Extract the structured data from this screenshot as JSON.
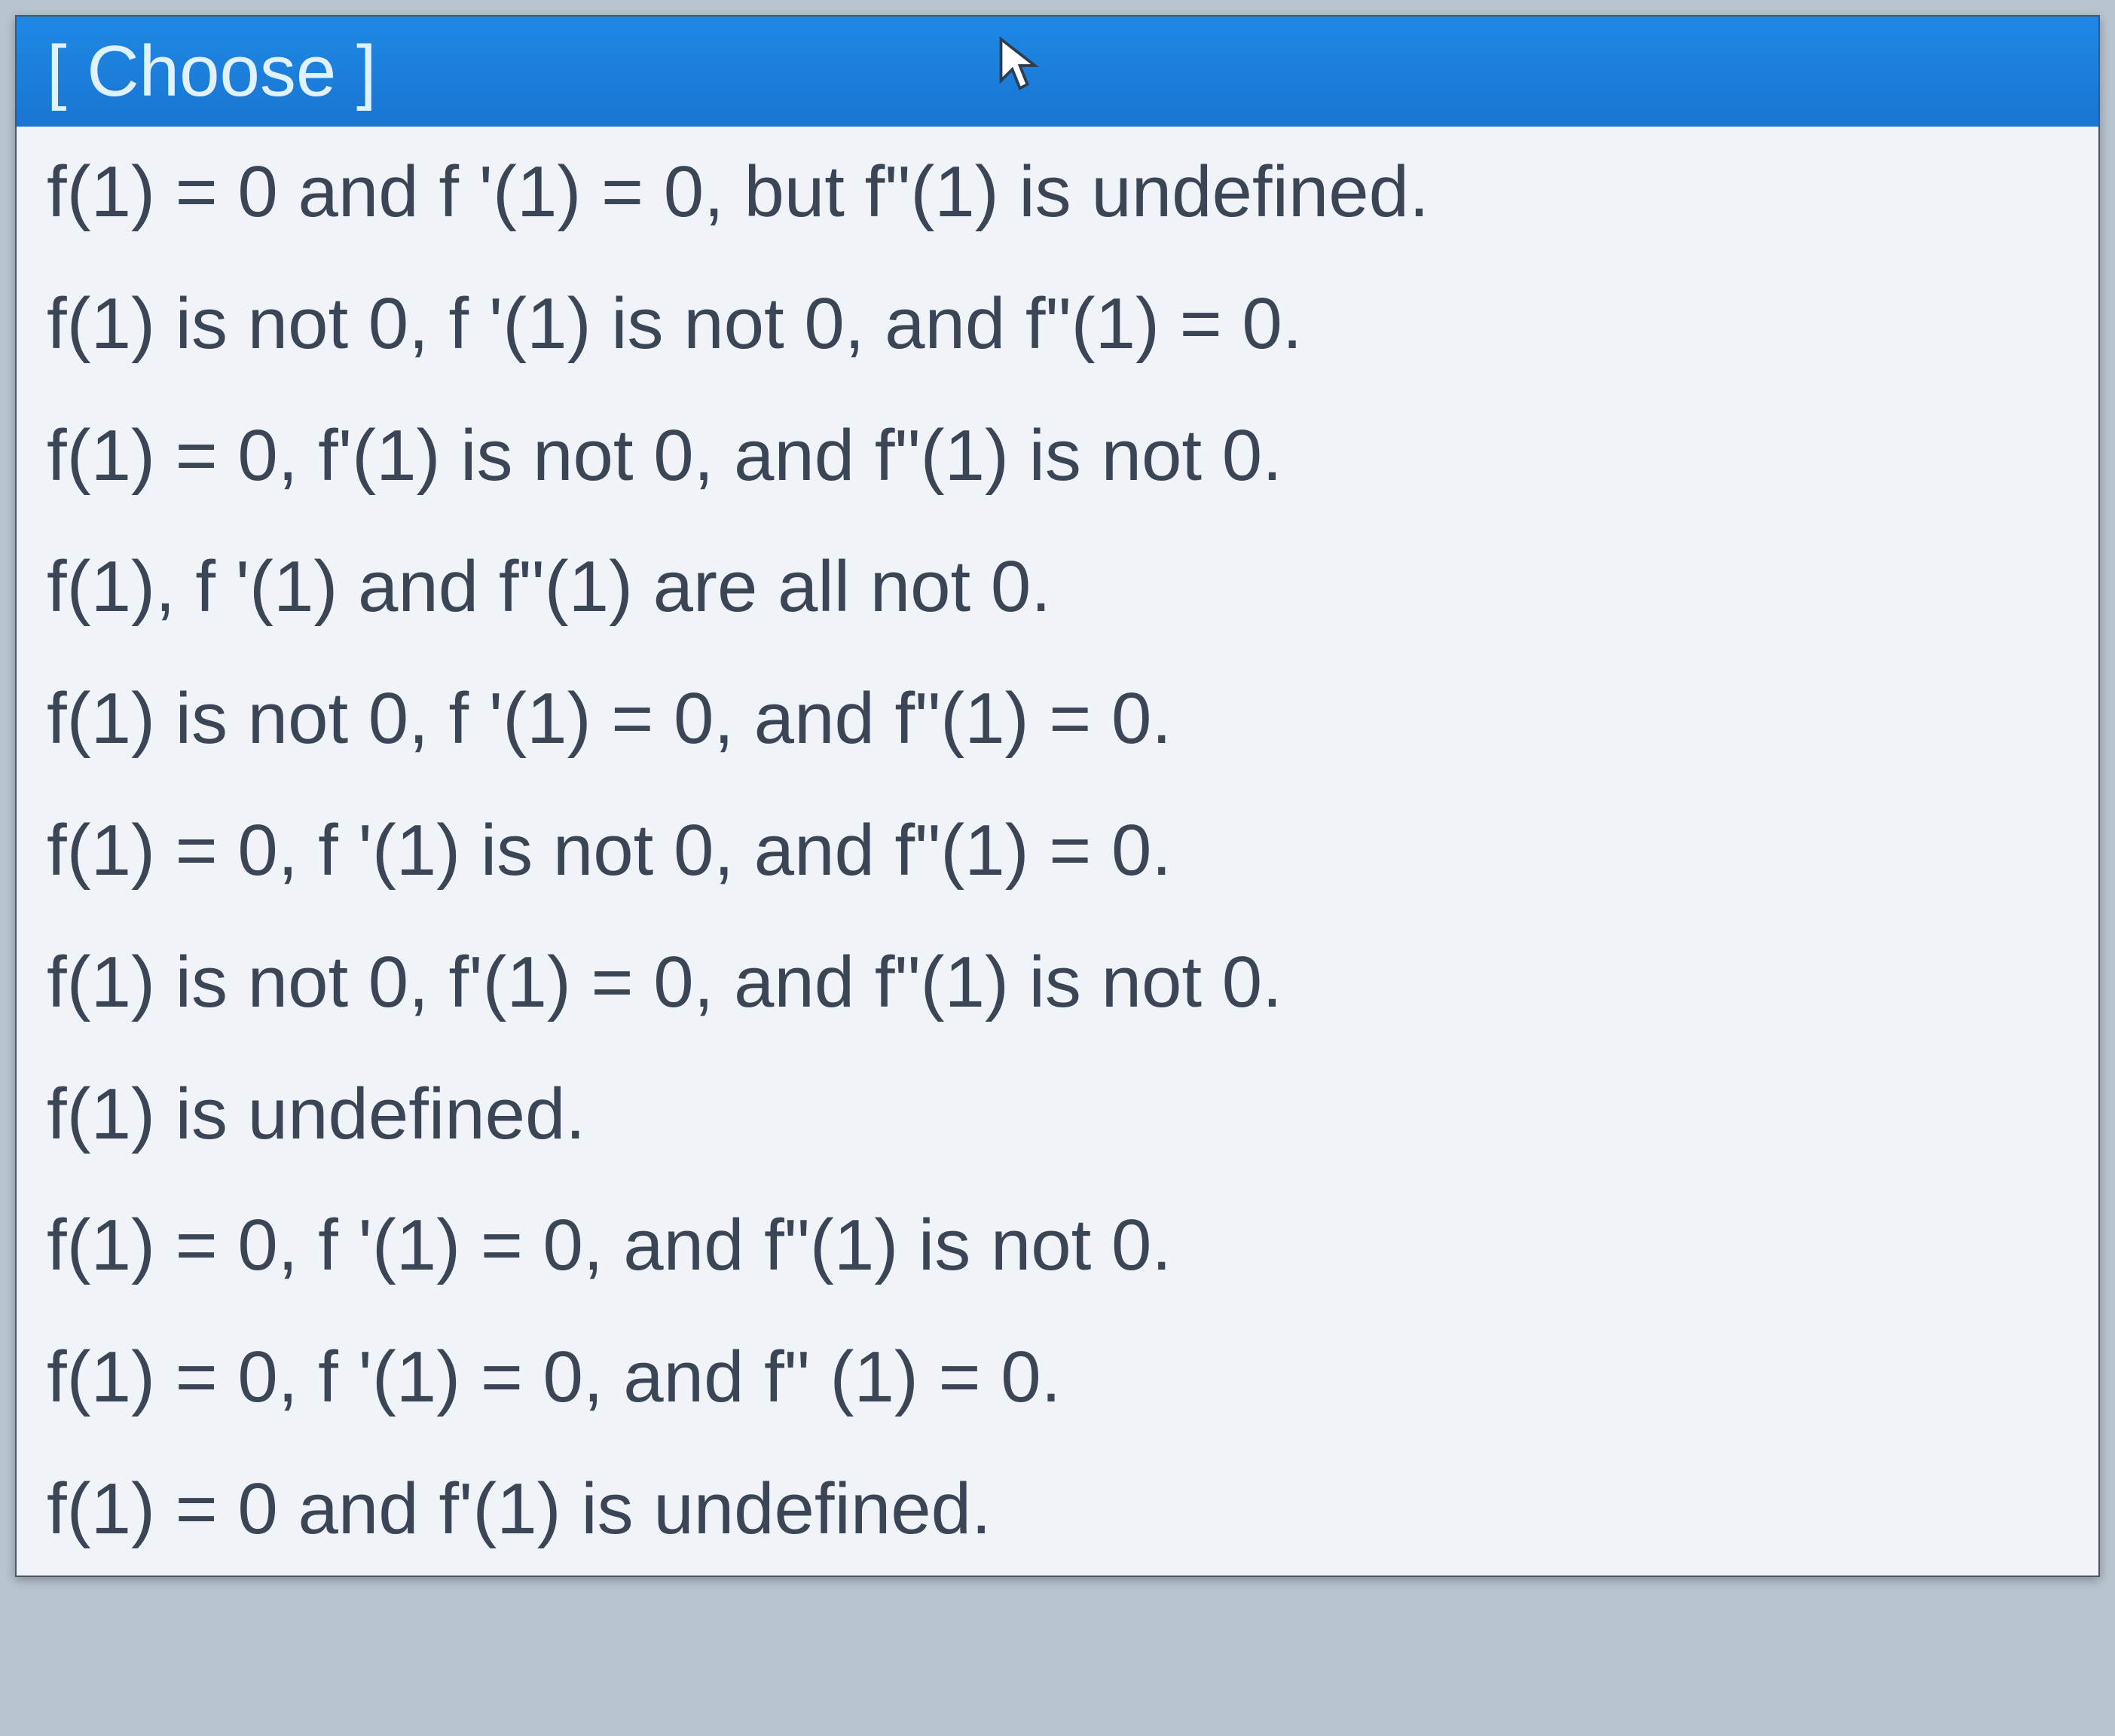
{
  "dropdown": {
    "placeholder": "[ Choose ]",
    "options": [
      "f(1) =  0 and f '(1) = 0, but f\"(1) is undefined.",
      "f(1) is not 0, f '(1) is not 0, and f\"(1) = 0.",
      "f(1) = 0, f'(1) is not 0, and f\"(1) is not 0.",
      "f(1), f '(1) and f\"(1) are all not 0.",
      "f(1) is not 0, f '(1) = 0, and f\"(1) = 0.",
      "f(1) = 0, f '(1) is not 0, and f\"(1) = 0.",
      "f(1) is not 0, f'(1) = 0, and f\"(1) is not 0.",
      "f(1)  is undefined.",
      "f(1) = 0, f '(1) = 0, and f\"(1) is not 0.",
      "f(1) = 0, f '(1) = 0, and f\" (1) = 0.",
      "f(1) = 0 and f'(1) is undefined."
    ]
  }
}
